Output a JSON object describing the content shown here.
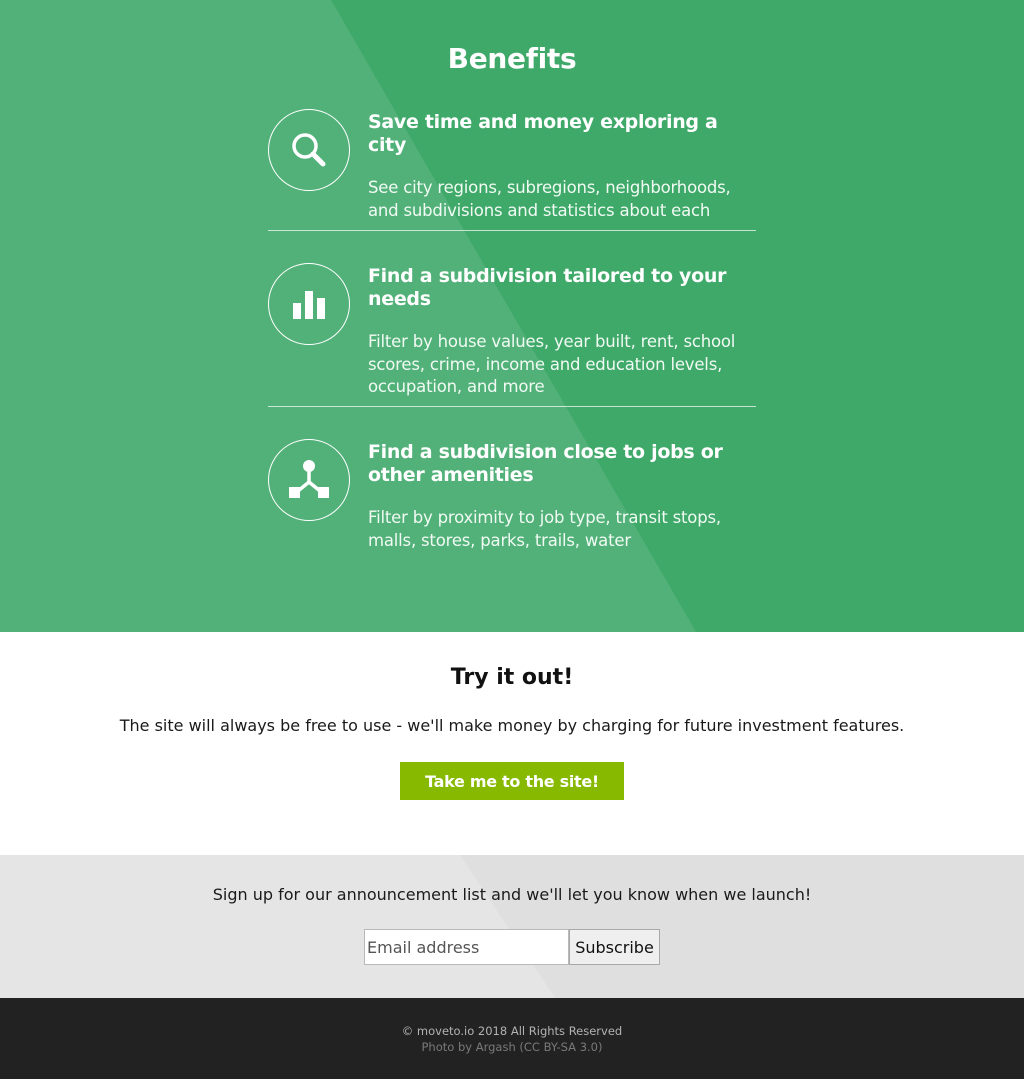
{
  "benefits": {
    "title": "Benefits",
    "items": [
      {
        "icon": "search-icon",
        "heading": "Save time and money exploring a city",
        "description": "See city regions, subregions, neighborhoods, and subdivisions and statistics about each"
      },
      {
        "icon": "bar-chart-icon",
        "heading": "Find a subdivision tailored to your needs",
        "description": "Filter by house values, year built, rent, school scores, crime, income and education levels, occupation, and more"
      },
      {
        "icon": "network-icon",
        "heading": "Find a subdivision close to jobs or other amenities",
        "description": "Filter by proximity to job type, transit stops, malls, stores, parks, trails, water"
      }
    ]
  },
  "try": {
    "title": "Try it out!",
    "text": "The site will always be free to use - we'll make money by charging for future investment features.",
    "button_label": "Take me to the site!"
  },
  "signup": {
    "text": "Sign up for our announcement list and we'll let you know when we launch!",
    "email_placeholder": "Email address",
    "subscribe_label": "Subscribe"
  },
  "footer": {
    "copyright": "© moveto.io 2018 All Rights Reserved",
    "credit": "Photo by Argash (CC BY-SA 3.0)"
  },
  "colors": {
    "benefits_bg": "#3fa96a",
    "cta_bg": "#86b900",
    "signup_bg": "#e5e5e5",
    "footer_bg": "#222222"
  }
}
